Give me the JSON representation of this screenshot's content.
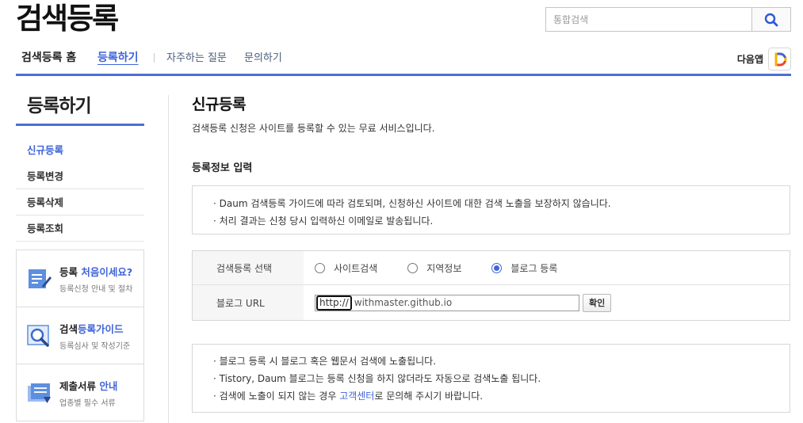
{
  "logo": "검색등록",
  "search": {
    "placeholder": "통합검색"
  },
  "gnb": {
    "home": "검색등록 홈",
    "register": "등록하기",
    "faq": "자주하는 질문",
    "inquiry": "문의하기",
    "app_label": "다음앱"
  },
  "sidebar": {
    "title": "등록하기",
    "items": [
      {
        "label": "신규등록",
        "active": true
      },
      {
        "label": "등록변경"
      },
      {
        "label": "등록삭제"
      },
      {
        "label": "등록조회"
      }
    ]
  },
  "promo": [
    {
      "title_pre": "등록 ",
      "title_hl": "처음이세요?",
      "title_post": "",
      "desc": "등록신청 안내 및 절차"
    },
    {
      "title_pre": "검색",
      "title_hl": "등록가이드",
      "title_post": "",
      "desc": "등록심사 및 작성기준"
    },
    {
      "title_pre": "제출서류 ",
      "title_hl": "안내",
      "title_post": "",
      "desc": "업종별 필수 서류"
    }
  ],
  "main": {
    "title": "신규등록",
    "desc": "검색등록 신청은 사이트를 등록할 수 있는 무료 서비스입니다.",
    "section_title": "등록정보 입력",
    "notice1": [
      "· Daum 검색등록 가이드에 따라 검토되며, 신청하신 사이트에 대한 검색 노출을 보장하지 않습니다.",
      "· 처리 결과는 신청 당시 입력하신 이메일로 발송됩니다."
    ],
    "form": {
      "select_label": "검색등록 선택",
      "options": [
        "사이트검색",
        "지역정보",
        "블로그 등록"
      ],
      "selected_index": 2,
      "url_label": "블로그 URL",
      "url_prefix": "http://",
      "url_value": "withmaster.github.io",
      "confirm": "확인"
    },
    "notice2": {
      "line1": "· 블로그 등록 시 블로그 혹은 웹문서 검색에 노출됩니다.",
      "line2": "· Tistory, Daum 블로그는 등록 신청을 하지 않더라도 자동으로 검색노출 됩니다.",
      "line3_pre": "· 검색에 노출이 되지 않는 경우 ",
      "line3_link": "고객센터",
      "line3_post": "로 문의해 주시기 바랍니다."
    }
  },
  "colors": {
    "accent": "#3f64d8",
    "border": "#d7d7d7"
  }
}
